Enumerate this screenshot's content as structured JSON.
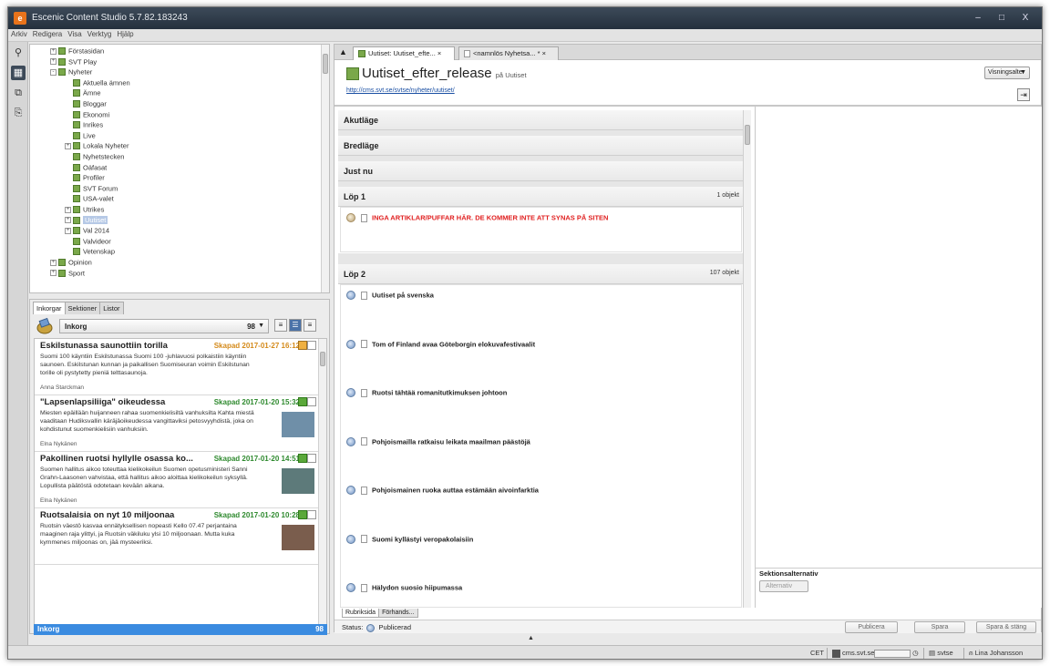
{
  "window": {
    "title": "Escenic Content Studio 5.7.82.183243",
    "controls": {
      "minimize": "–",
      "maximize": "□",
      "close": "X"
    }
  },
  "menu": [
    "Arkiv",
    "Redigera",
    "Visa",
    "Verktyg",
    "Hjälp"
  ],
  "tree": {
    "items": [
      {
        "label": "Förstasidan",
        "level": 1,
        "expander": "+"
      },
      {
        "label": "SVT Play",
        "level": 1,
        "expander": "+"
      },
      {
        "label": "Nyheter",
        "level": 1,
        "expander": "-"
      },
      {
        "label": "Aktuella ämnen",
        "level": 2,
        "expander": ""
      },
      {
        "label": "Ämne",
        "level": 2,
        "expander": ""
      },
      {
        "label": "Bloggar",
        "level": 2,
        "expander": ""
      },
      {
        "label": "Ekonomi",
        "level": 2,
        "expander": ""
      },
      {
        "label": "Inrikes",
        "level": 2,
        "expander": ""
      },
      {
        "label": "Live",
        "level": 2,
        "expander": ""
      },
      {
        "label": "Lokala Nyheter",
        "level": 2,
        "expander": "+"
      },
      {
        "label": "Nyhetstecken",
        "level": 2,
        "expander": ""
      },
      {
        "label": "Oäfasat",
        "level": 2,
        "expander": ""
      },
      {
        "label": "Profiler",
        "level": 2,
        "expander": ""
      },
      {
        "label": "SVT Forum",
        "level": 2,
        "expander": ""
      },
      {
        "label": "USA-valet",
        "level": 2,
        "expander": ""
      },
      {
        "label": "Utrikes",
        "level": 2,
        "expander": "+"
      },
      {
        "label": "Uutiset",
        "level": 2,
        "expander": "+",
        "selected": true
      },
      {
        "label": "Val 2014",
        "level": 2,
        "expander": "+"
      },
      {
        "label": "Valvideor",
        "level": 2,
        "expander": ""
      },
      {
        "label": "Vetenskap",
        "level": 2,
        "expander": ""
      },
      {
        "label": "Opinion",
        "level": 1,
        "expander": "+"
      },
      {
        "label": "Sport",
        "level": 1,
        "expander": "+"
      }
    ]
  },
  "inbox": {
    "tabs": [
      "Inkorgar",
      "Sektioner",
      "Listor"
    ],
    "selected": "Inkorg",
    "count": "98",
    "footer_label": "Inkorg",
    "footer_count": "98",
    "cards": [
      {
        "title": "Eskilstunassa saunottiin torilla",
        "created": "Skapad 2017-01-27 16:12",
        "created_color": "#d48a1a",
        "body": "Suomi 100 käyntiin Eskilstunassa Suomi 100 -juhlavuosi polkaistiin käyntiin saunoen. Eskilstunan kunnan ja paikallisen Suomiseuran voimin Eskilstunan torille oli pystytetty pieniä telttasaunoja.",
        "author": "Anna Starckman",
        "thumb": false
      },
      {
        "title": "\"Lapsenlapsiliiga\" oikeudessa",
        "created": "Skapad 2017-01-20 15:32",
        "created_color": "#2f8a2f",
        "body": "Miesten epäillään huijanneen rahaa suomenkielisiltä vanhuksilta Kahta miestä vaaditaan Hudiksvallin käräjäoikeudessa vangittaviksi petosvyyhdistä, joka on kohdistunut suomenkielisiin vanhuksiin.",
        "author": "Elna Nykänen",
        "thumb": true
      },
      {
        "title": "Pakollinen ruotsi hyllylle osassa ko...",
        "created": "Skapad 2017-01-20 14:51",
        "created_color": "#2f8a2f",
        "body": "Suomen hallitus aikoo toteuttaa kielikokeilun Suomen opetusministeri Sanni Grahn-Laasonen vahvistaa, että hallitus aikoo aloittaa kielikokeilun syksyllä. Lopullista päätöstä odotetaan kevään aikana.",
        "author": "Elna Nykänen",
        "thumb": true
      },
      {
        "title": "Ruotsalaisia on nyt 10 miljoonaa",
        "created": "Skapad 2017-01-20 10:28",
        "created_color": "#2f8a2f",
        "body": "Ruotsin väestö kasvaa ennätyksellisen nopeasti Kello 07.47 perjantaina maaginen raja ylittyi, ja Ruotsin väkiluku ylsi 10 miljoonaan. Mutta kuka kymmenes miljoonas on, jää mysteeriksi.",
        "author": "",
        "thumb": true
      }
    ]
  },
  "main": {
    "tabs": [
      "Uutiset: Uutiset_efte... ×",
      "<namnlös Nyhetsa... * ×"
    ],
    "section_title": "Uutiset_efter_release",
    "section_sub": "på Uutiset",
    "section_url": "http://cms.svt.se/svtse/nyheter/uutiset/",
    "views_label": "Visningsalter",
    "lanes": [
      {
        "name": "Akutläge",
        "count": ""
      },
      {
        "name": "Bredläge",
        "count": ""
      },
      {
        "name": "Just nu",
        "count": ""
      },
      {
        "name": "Löp 1",
        "count": "1 objekt"
      },
      {
        "name": "Löp 2",
        "count": "107 objekt"
      }
    ],
    "lop1_items": [
      {
        "title": "INGA ARTIKLAR/PUFFAR HÄR. DE KOMMER INTE ATT SYNAS PÅ SITEN"
      }
    ],
    "lop2_items": [
      {
        "title": "Uutiset på svenska"
      },
      {
        "title": "Tom of Finland avaa Göteborgin elokuvafestivaalit"
      },
      {
        "title": "Ruotsi tähtää romanitutkimuksen johtoon"
      },
      {
        "title": "Pohjoismailla ratkaisu leikata maailman päästöjä"
      },
      {
        "title": "Pohjoismainen ruoka auttaa estämään aivoinfarktia"
      },
      {
        "title": "Suomi kyllästyi veropakolaisiin"
      },
      {
        "title": "Hälydon suosio hiipumassa"
      }
    ],
    "section_options_label": "Sektionsalternativ",
    "alternative_btn": "Alternativ",
    "bottom_tabs": [
      "Rubriksida",
      "Förhands..."
    ],
    "status_label": "Status:",
    "status_value": "Publicerad",
    "publish_btn": "Publicera",
    "save_btn": "Spara",
    "save_close_btn": "Spara & stäng"
  },
  "taskbar": {
    "tz": "CET",
    "host": "cms.svt.se",
    "publication": "svtse",
    "user": "Lina Johansson"
  }
}
